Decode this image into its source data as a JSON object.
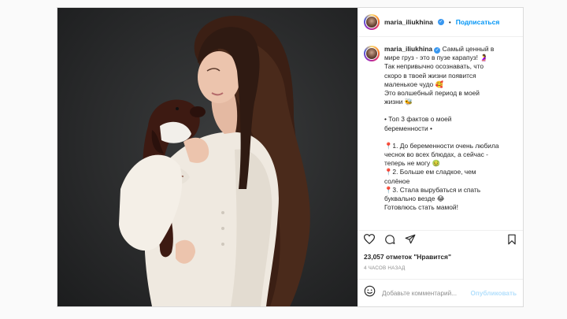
{
  "header": {
    "username": "maria_iliukhina",
    "separator": "•",
    "follow_label": "Подписаться"
  },
  "caption": {
    "username": "maria_iliukhina",
    "lines": [
      "Самый ценный в",
      "мире груз - это в пузе карапуз! 🤰",
      "Так непривычно осознавать, что",
      "скоро в твоей жизни появится",
      "маленькое чудо 🥰",
      "Это волшебный период в моей",
      "жизни 🐝",
      "",
      "• Топ 3 фактов о моей",
      "беременности •",
      "",
      "📍1. До беременности очень любила",
      "чеснок во всех блюдах, а сейчас -",
      "теперь не могу 🤢",
      "📍2. Больше ем сладкое, чем",
      "солёное",
      "📍3. Стала вырубаться и спать",
      "буквально везде 😂",
      "Готовлюсь стать мамой!"
    ]
  },
  "likes": "23,057 отметок \"Нравится\"",
  "time": "4 ЧАСОВ НАЗАД",
  "comment": {
    "placeholder": "Добавьте комментарий...",
    "post_label": "Опубликовать"
  },
  "icons": {
    "like": "heart-icon",
    "comment": "comment-icon",
    "share": "share-icon",
    "save": "bookmark-icon",
    "emoji": "emoji-icon",
    "verified": "verified-badge-icon"
  },
  "colors": {
    "accent": "#0095f6",
    "verified": "#3897f0",
    "muted": "#8e8e8e"
  }
}
